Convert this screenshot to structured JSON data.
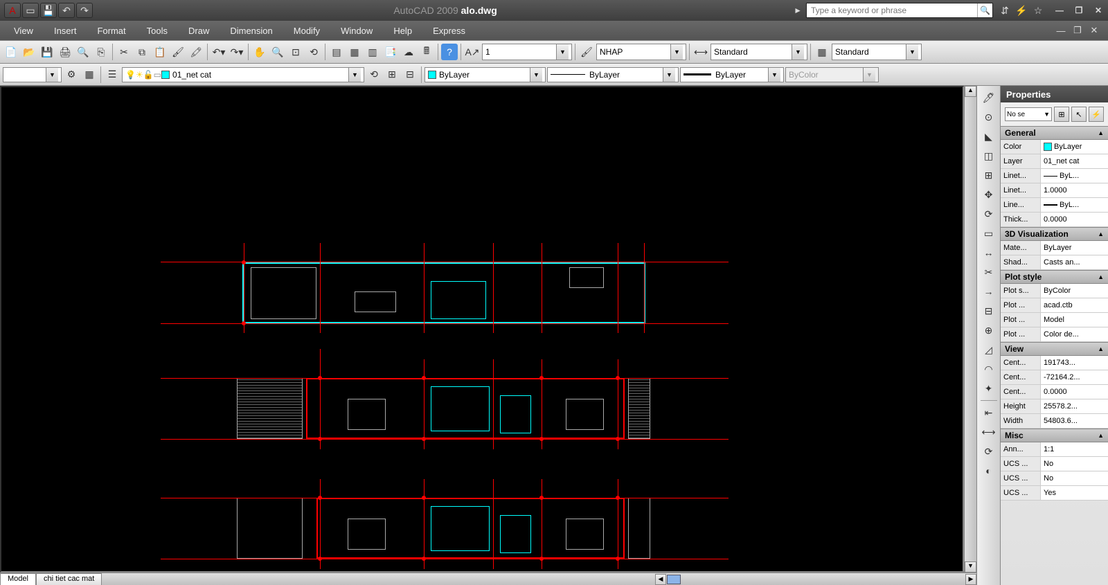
{
  "titlebar": {
    "app": "AutoCAD 2009",
    "file": "alo.dwg",
    "search_placeholder": "Type a keyword or phrase"
  },
  "menu": [
    "View",
    "Insert",
    "Format",
    "Tools",
    "Draw",
    "Dimension",
    "Modify",
    "Window",
    "Help",
    "Express"
  ],
  "toolbar": {
    "scale_value": "1",
    "text_style": "NHAP",
    "dim_style": "Standard",
    "table_style": "Standard"
  },
  "layer_bar": {
    "current_layer": "01_net cat",
    "color": "ByLayer",
    "linetype": "ByLayer",
    "lineweight": "ByLayer",
    "plot_style": "ByColor"
  },
  "tabs": {
    "model": "Model",
    "layout1": "chi tiet cac mat"
  },
  "properties": {
    "title": "Properties",
    "selection": "No se",
    "general": {
      "label": "General",
      "color_label": "Color",
      "color_value": "ByLayer",
      "layer_label": "Layer",
      "layer_value": "01_net cat",
      "linetype_label": "Linet...",
      "linetype_value": "ByL...",
      "ltscale_label": "Linet...",
      "ltscale_value": "1.0000",
      "lineweight_label": "Line...",
      "lineweight_value": "ByL...",
      "thickness_label": "Thick...",
      "thickness_value": "0.0000"
    },
    "viz": {
      "label": "3D Visualization",
      "material_label": "Mate...",
      "material_value": "ByLayer",
      "shadow_label": "Shad...",
      "shadow_value": "Casts an..."
    },
    "plot": {
      "label": "Plot style",
      "plot_style_label": "Plot s...",
      "plot_style_value": "ByColor",
      "plot_table_label": "Plot ...",
      "plot_table_value": "acad.ctb",
      "plot_attach_label": "Plot ...",
      "plot_attach_value": "Model",
      "plot_type_label": "Plot ...",
      "plot_type_value": "Color de..."
    },
    "view": {
      "label": "View",
      "centerx_label": "Cent...",
      "centerx_value": "191743...",
      "centery_label": "Cent...",
      "centery_value": "-72164.2...",
      "centerz_label": "Cent...",
      "centerz_value": "0.0000",
      "height_label": "Height",
      "height_value": "25578.2...",
      "width_label": "Width",
      "width_value": "54803.6..."
    },
    "misc": {
      "label": "Misc",
      "anno_label": "Ann...",
      "anno_value": "1:1",
      "ucs1_label": "UCS ...",
      "ucs1_value": "No",
      "ucs2_label": "UCS ...",
      "ucs2_value": "No",
      "ucs3_label": "UCS ...",
      "ucs3_value": "Yes"
    }
  }
}
